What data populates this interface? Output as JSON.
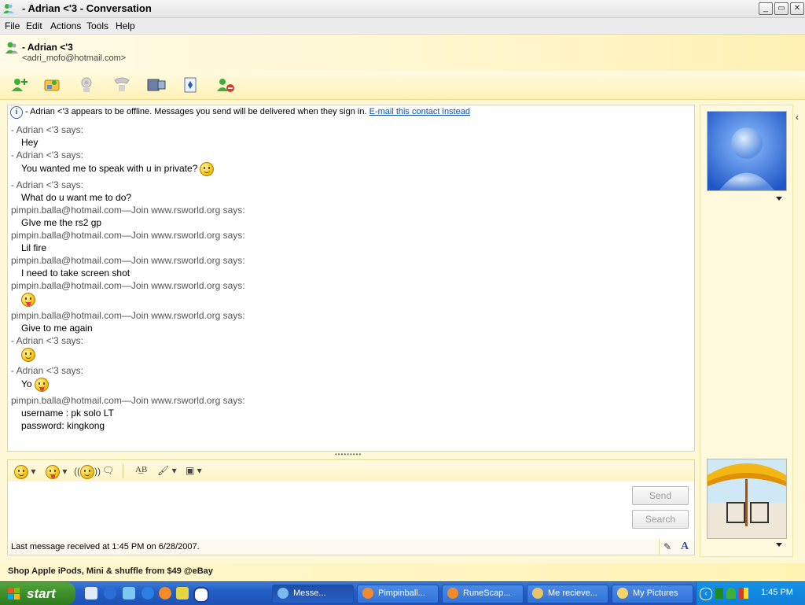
{
  "window": {
    "title": "-   Adrian <'3 - Conversation",
    "minimize_icon": "minimize-icon",
    "maximize_icon": "maximize-icon",
    "close_icon": "close-icon"
  },
  "menu": [
    "File",
    "Edit",
    "Actions",
    "Tools",
    "Help"
  ],
  "contact": {
    "name": "-   Adrian <'3",
    "email": "<adri_mofo@hotmail.com>"
  },
  "toolbar": {
    "buttons": [
      "invite-contact",
      "send-files",
      "webcam",
      "call",
      "activities",
      "games",
      "block"
    ]
  },
  "infobar": {
    "prefix": "-   Adrian <'3 appears to be offline. Messages you send will be delivered when they sign in.",
    "link": "E-mail this contact instead"
  },
  "conversation": [
    {
      "type": "says",
      "text": "-   Adrian <'3 says:"
    },
    {
      "type": "msg",
      "text": "Hey"
    },
    {
      "type": "says",
      "text": "-   Adrian <'3 says:"
    },
    {
      "type": "msg",
      "text": "You wanted me to speak with u in private?",
      "emoticon": "smile"
    },
    {
      "type": "says",
      "text": "-   Adrian <'3 says:"
    },
    {
      "type": "msg",
      "text": "What do u want me to do?"
    },
    {
      "type": "says",
      "text": "pimpin.balla@hotmail.com—Join www.rsworld.org says:"
    },
    {
      "type": "msg",
      "text": "GIve me the rs2 gp"
    },
    {
      "type": "says",
      "text": "pimpin.balla@hotmail.com—Join www.rsworld.org says:"
    },
    {
      "type": "msg",
      "text": "Lil  fire"
    },
    {
      "type": "says",
      "text": "pimpin.balla@hotmail.com—Join www.rsworld.org says:"
    },
    {
      "type": "msg",
      "text": "I need to take screen shot"
    },
    {
      "type": "says",
      "text": "pimpin.balla@hotmail.com—Join www.rsworld.org says:"
    },
    {
      "type": "msg",
      "text": "",
      "emoticon": "tongue"
    },
    {
      "type": "says",
      "text": "pimpin.balla@hotmail.com—Join www.rsworld.org says:"
    },
    {
      "type": "msg",
      "text": "Give to me again"
    },
    {
      "type": "says",
      "text": "-   Adrian <'3 says:"
    },
    {
      "type": "msg",
      "text": "",
      "emoticon": "smile"
    },
    {
      "type": "says",
      "text": "-   Adrian <'3 says:"
    },
    {
      "type": "msg",
      "text": "Yo",
      "emoticon": "tongue"
    },
    {
      "type": "says",
      "text": "pimpin.balla@hotmail.com—Join www.rsworld.org says:"
    },
    {
      "type": "msg",
      "text": "username : pk solo LT"
    },
    {
      "type": "msg",
      "text": "password: kingkong"
    }
  ],
  "compose": {
    "send_label": "Send",
    "search_label": "Search",
    "status": "Last message received at 1:45 PM on 6/28/2007."
  },
  "ad": {
    "text": "Shop Apple iPods, Mini & shuffle from $49 @eBay"
  },
  "taskbar": {
    "start_label": "start",
    "tasks": [
      {
        "label": "Messe...",
        "active": true,
        "color": "#7ab8f0"
      },
      {
        "label": "Pimpinball...",
        "active": false,
        "color": "#f18b2b"
      },
      {
        "label": "RuneScap...",
        "active": false,
        "color": "#f18b2b"
      },
      {
        "label": "Me recieve...",
        "active": false,
        "color": "#e9c46a"
      },
      {
        "label": "My Pictures",
        "active": false,
        "color": "#f5d36b"
      }
    ],
    "clock": "1:45 PM"
  }
}
